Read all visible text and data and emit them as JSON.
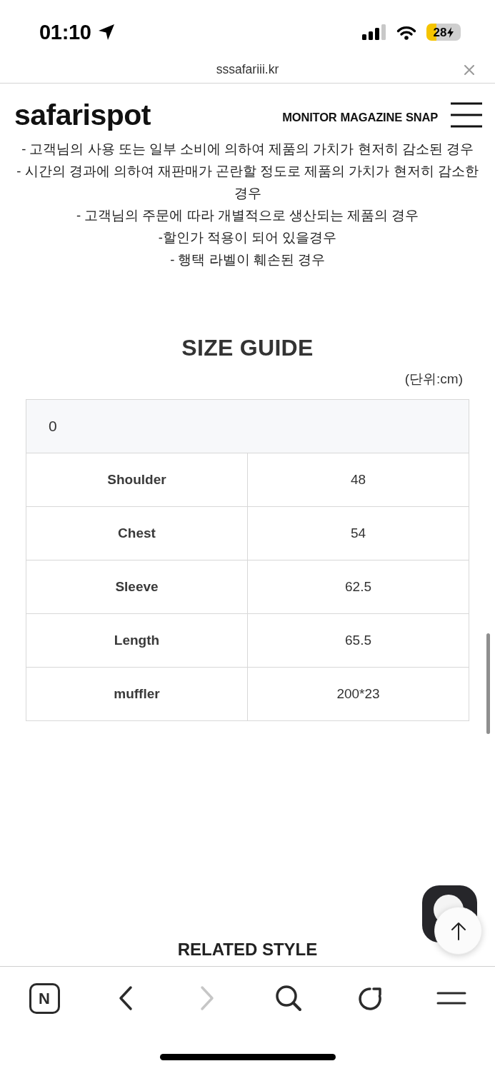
{
  "status_bar": {
    "time": "01:10",
    "battery": "28"
  },
  "address_bar": {
    "url": "sssafariii.kr"
  },
  "site_header": {
    "logo": "safarispot",
    "nav": [
      "MONITOR",
      "MAGAZINE",
      "SNAP"
    ]
  },
  "notice_lines": [
    "- 고객님의 사용 또는 일부 소비에 의하여 제품의 가치가 현저히 감소된 경우",
    "- 시간의 경과에 의하여 재판매가 곤란할 정도로 제품의 가치가 현저히 감소한 경우",
    "- 고객님의 주문에 따라 개별적으로 생산되는 제품의 경우",
    "-할인가 적용이 되어 있을경우",
    "- 행택 라벨이 훼손된 경우"
  ],
  "size_guide": {
    "title": "SIZE GUIDE",
    "unit": "(단위:cm)",
    "header": "0",
    "rows": [
      {
        "label": "Shoulder",
        "value": "48"
      },
      {
        "label": "Chest",
        "value": "54"
      },
      {
        "label": "Sleeve",
        "value": "62.5"
      },
      {
        "label": "Length",
        "value": "65.5"
      },
      {
        "label": "muffler",
        "value": "200*23"
      }
    ]
  },
  "related_style": {
    "title": "RELATED STYLE"
  },
  "toolbar": [
    {
      "kind": "home",
      "label": "N",
      "disabled": false
    },
    {
      "kind": "back",
      "disabled": false
    },
    {
      "kind": "forward",
      "disabled": true
    },
    {
      "kind": "search",
      "disabled": false
    },
    {
      "kind": "reload",
      "disabled": false
    },
    {
      "kind": "menu",
      "disabled": false
    }
  ]
}
